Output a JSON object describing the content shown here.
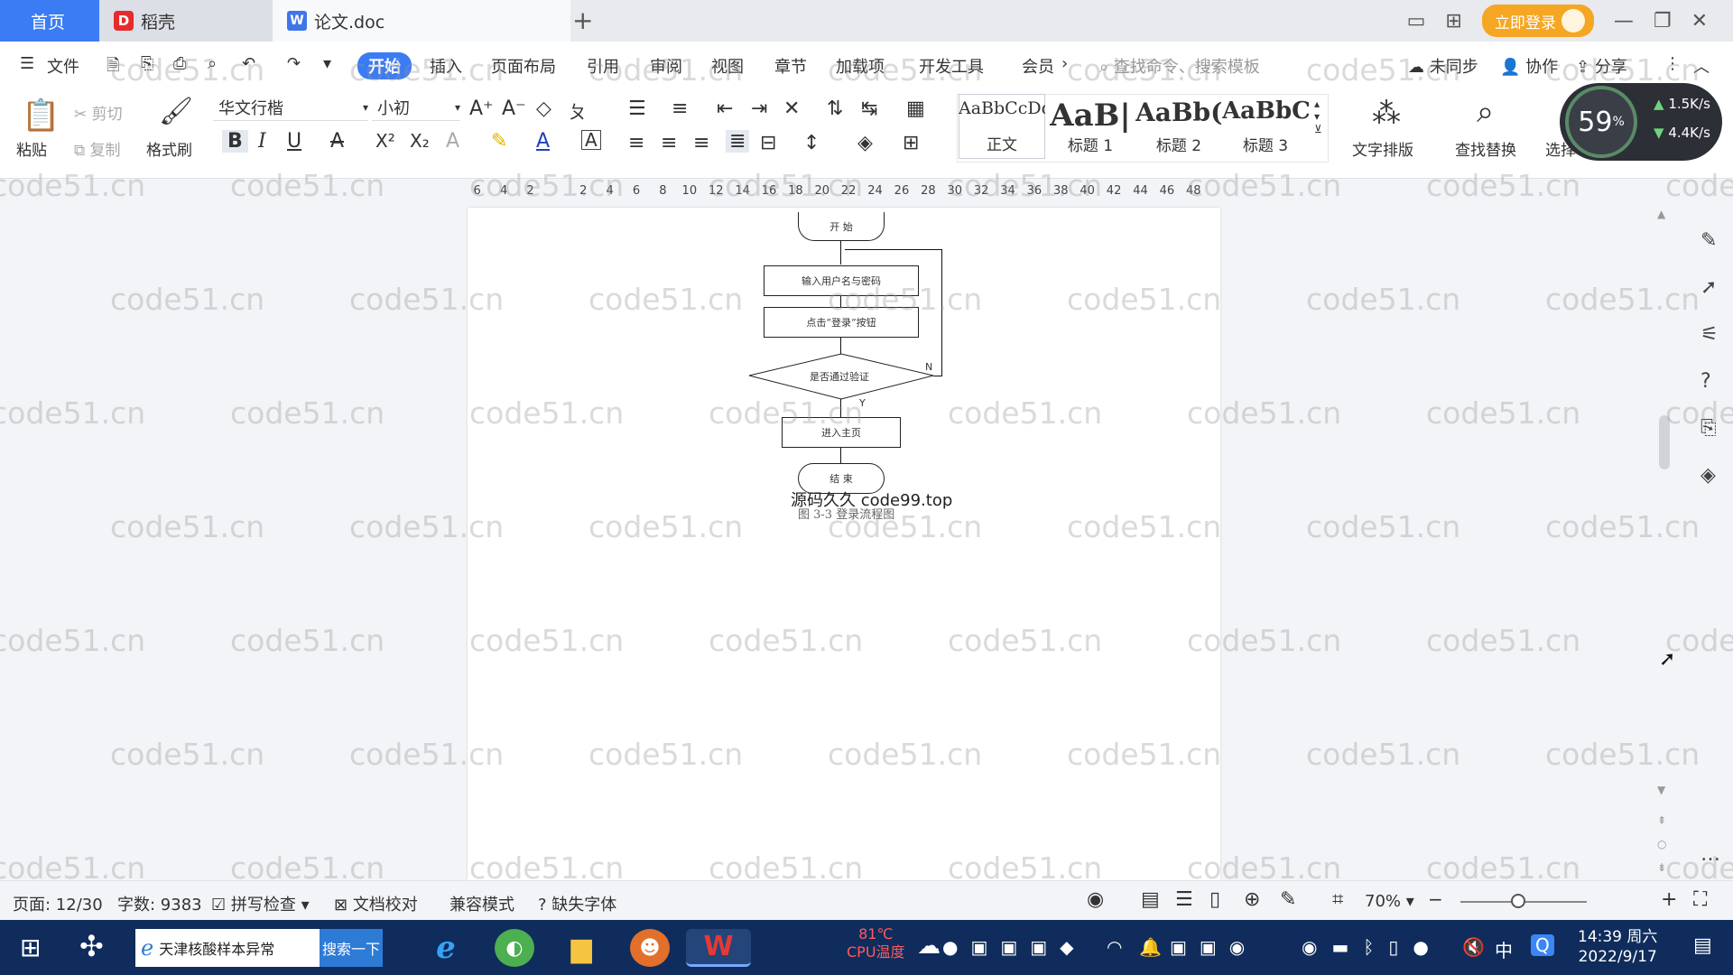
{
  "tabs": {
    "home": "首页",
    "daoke": "稻壳",
    "doc": "论文.doc",
    "login": "立即登录"
  },
  "menu": {
    "file": "文件",
    "items": [
      "开始",
      "插入",
      "页面布局",
      "引用",
      "审阅",
      "视图",
      "章节",
      "加载项",
      "开发工具",
      "会员"
    ],
    "search_cmd": "查找命令、搜索模板",
    "sync": "未同步",
    "collab": "协作",
    "share": "分享"
  },
  "ribbon": {
    "paste": "粘贴",
    "cut": "剪切",
    "copy": "复制",
    "format_painter": "格式刷",
    "font_name": "华文行楷",
    "font_size": "小初",
    "styles": [
      {
        "preview": "AaBbCcDd",
        "name": "正文"
      },
      {
        "preview": "AaB|",
        "name": "标题 1"
      },
      {
        "preview": "AaBb(",
        "name": "标题 2"
      },
      {
        "preview": "AaBbC",
        "name": "标题 3"
      }
    ],
    "text_layout": "文字排版",
    "find_replace": "查找替换",
    "select": "选择"
  },
  "speed_widget": {
    "percent": "59",
    "up": "1.5K/s",
    "down": "4.4K/s"
  },
  "ruler_ticks": [
    "6",
    "4",
    "2",
    "",
    "2",
    "4",
    "6",
    "8",
    "10",
    "12",
    "14",
    "16",
    "18",
    "20",
    "22",
    "24",
    "26",
    "28",
    "30",
    "32",
    "34",
    "36",
    "38",
    "40",
    "42",
    "44",
    "46",
    "48"
  ],
  "flowchart": {
    "start": "开 始",
    "input": "输入用户名与密码",
    "click": "点击“登录”按钮",
    "verify": "是否通过验证",
    "no": "N",
    "yes": "Y",
    "enter": "进入主页",
    "end": "结 束"
  },
  "overlay_text": "源码久久 code99.top",
  "caption": "图 3-3  登录流程图",
  "status": {
    "page": "页面: 12/30",
    "words": "字数: 9383",
    "spell": "拼写检查",
    "proof": "文档校对",
    "compat": "兼容模式",
    "missing_font": "缺失字体",
    "zoom": "70%"
  },
  "taskbar": {
    "search_text": "天津核酸样本异常",
    "search_btn": "搜索一下",
    "temp": "81℃",
    "temp_label": "CPU温度",
    "ime": "中",
    "time": "14:39 周六",
    "date": "2022/9/17"
  },
  "watermark": "code51.cn"
}
